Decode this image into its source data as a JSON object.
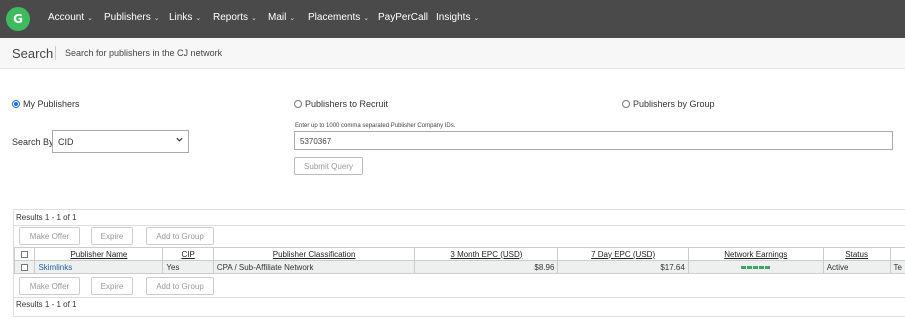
{
  "nav": {
    "logo_letter": "G",
    "items": [
      {
        "label": "Account",
        "has_menu": true
      },
      {
        "label": "Publishers",
        "has_menu": true
      },
      {
        "label": "Links",
        "has_menu": true
      },
      {
        "label": "Reports",
        "has_menu": true
      },
      {
        "label": "Mail",
        "has_menu": true
      },
      {
        "label": "Placements",
        "has_menu": true
      },
      {
        "label": "PayPerCall",
        "has_menu": false
      },
      {
        "label": "Insights",
        "has_menu": true
      }
    ],
    "chevron": "⌄",
    "colors": {
      "bar": "#4a4a4a",
      "logo": "#3dbb5e"
    }
  },
  "page": {
    "title": "Search",
    "description": "Search for publishers in the CJ network"
  },
  "search": {
    "options": [
      {
        "label": "My Publishers",
        "selected": true
      },
      {
        "label": "Publishers to Recruit",
        "selected": false
      },
      {
        "label": "Publishers by Group",
        "selected": false
      }
    ],
    "search_by_label": "Search By:",
    "search_by_value": "CID",
    "hint": "Enter up to 1000 comma separated Publisher Company IDs.",
    "ids_value": "5370367",
    "submit_label": "Submit Query"
  },
  "results": {
    "count_text": "Results 1 - 1 of 1",
    "actions": [
      "Make Offer",
      "Expire",
      "Add to Group"
    ],
    "columns": [
      "",
      "Publisher Name",
      "CIP",
      "Publisher Classification",
      "3 Month EPC (USD)",
      "7 Day EPC (USD)",
      "Network Earnings",
      "Status",
      ""
    ],
    "rows": [
      {
        "publisher_name": "Skimlinks",
        "cip": "Yes",
        "classification": "CPA / Sub-Affiliate Network",
        "epc_3m": "$8.96",
        "epc_7d": "$17.64",
        "network_earnings_level": 5,
        "status": "Active",
        "extra": "Te"
      }
    ],
    "earnings_bar_color": "#3aa862"
  }
}
